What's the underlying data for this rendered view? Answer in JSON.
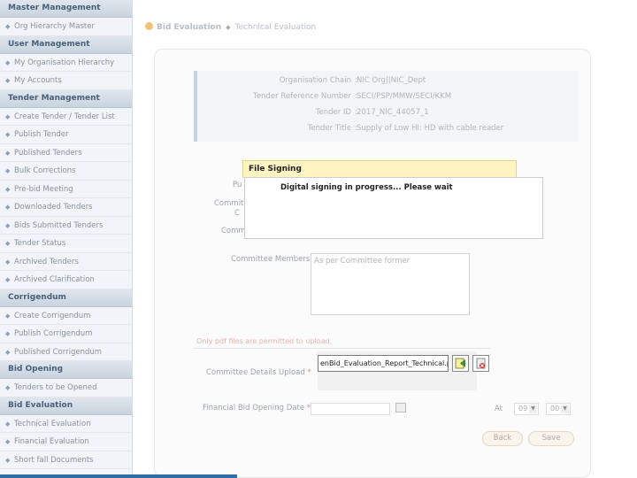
{
  "sidebar": {
    "sections": [
      {
        "title": "Master Management",
        "items": [
          "Org Hierarchy Master"
        ]
      },
      {
        "title": "User Management",
        "items": [
          "My Organisation Hierarchy",
          "My Accounts"
        ]
      },
      {
        "title": "Tender Management",
        "items": [
          "Create Tender / Tender List",
          "Publish Tender",
          "Published Tenders",
          "Bulk Corrections",
          "Pre-bid Meeting",
          "Downloaded Tenders",
          "Bids Submitted Tenders",
          "Tender Status",
          "Archived Tenders",
          "Archived Clarification"
        ]
      },
      {
        "title": "Corrigendum",
        "items": [
          "Create Corrigendum",
          "Publish Corrigendum",
          "Published Corrigendum"
        ]
      },
      {
        "title": "Bid Opening",
        "items": [
          "Tenders to be Opened"
        ]
      },
      {
        "title": "Bid Evaluation",
        "items": [
          "Technical Evaluation",
          "Financial Evaluation",
          "Short fall Documents"
        ]
      }
    ]
  },
  "breadcrumb": {
    "parent": "Bid Evaluation",
    "current": "Technical Evaluation"
  },
  "info": {
    "org_chain_label": "Organisation Chain",
    "org_chain_value": "NIC Org||NIC_Dept",
    "ref_label": "Tender Reference Number",
    "ref_value": "SECI/PSP/MMW/SECI/KKM",
    "id_label": "Tender ID",
    "id_value": "2017_NIC_44057_1",
    "title_label": "Tender Title",
    "title_value": "Supply of Low HI: HD with cable reader"
  },
  "form": {
    "label_pu": "Pu",
    "label_committee_1": "Committ",
    "label_committee_1b": "C",
    "label_committee_2": "Comm",
    "committee_members_label": "Committee Members",
    "committee_members_value": "As per Committee former",
    "warning": "Only pdf files are permitted to upload.",
    "upload_label": "Committee Details Upload",
    "required_mark": "*",
    "file_name": "enBid_Evaluation_Report_Technical.pdf",
    "financial_label": "Financial Bid Opening Date",
    "at_label": "At",
    "hour": "09",
    "minute": "00",
    "back_label": "Back",
    "save_label": "Save"
  },
  "dialog": {
    "title": "File Signing",
    "message": "Digital signing in progress... Please wait"
  }
}
